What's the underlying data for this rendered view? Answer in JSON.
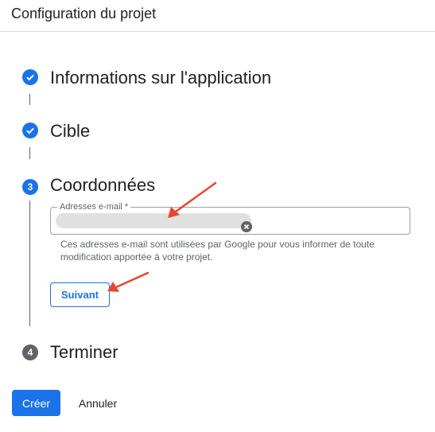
{
  "header": {
    "title": "Configuration du projet"
  },
  "steps": [
    {
      "label": "Informations sur l'application",
      "status": "completed",
      "icon": "check-icon"
    },
    {
      "label": "Cible",
      "status": "completed",
      "icon": "check-icon"
    },
    {
      "label": "Coordonnées",
      "status": "active",
      "number": "3"
    },
    {
      "label": "Terminer",
      "status": "pending",
      "number": "4"
    }
  ],
  "contact": {
    "email_label": "Adresses e-mail *",
    "help_text": "Ces adresses e-mail sont utilisées par Google pour vous informer de toute modification apportée à votre projet.",
    "clear_icon": "clear-icon",
    "next_label": "Suivant"
  },
  "actions": {
    "create_label": "Créer",
    "cancel_label": "Annuler"
  },
  "colors": {
    "accent": "#1a73e8",
    "annotation_arrow": "#e8452c",
    "pending_step": "#5f6368",
    "chip": "#e0e0e0"
  }
}
